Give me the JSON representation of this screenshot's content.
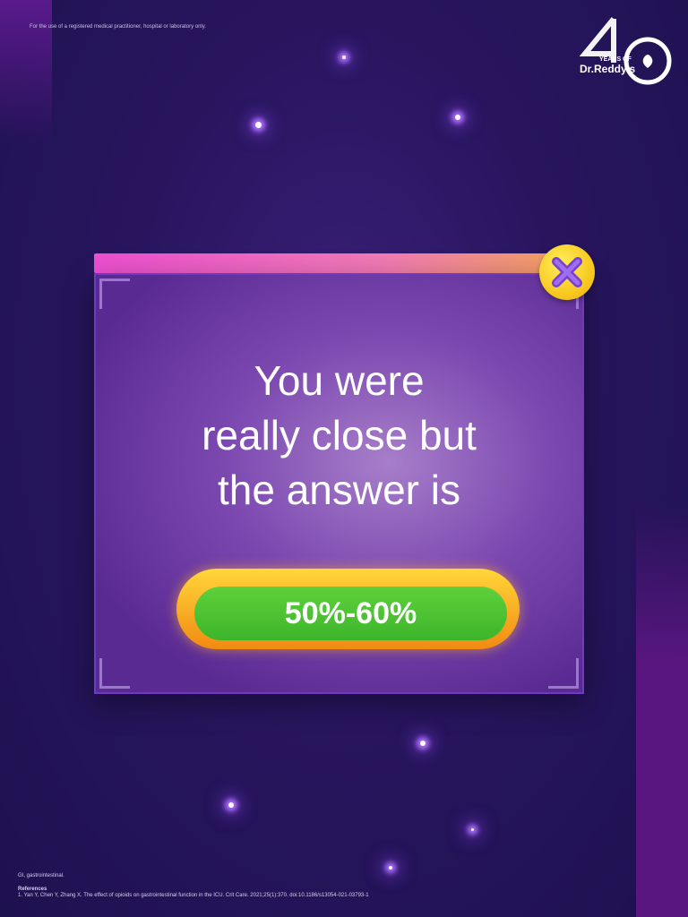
{
  "header": {
    "disclaimer": "For the use of a registered medical practitioner, hospital or laboratory only.",
    "logo_text": "40 YEARS OF Dr.Reddy's"
  },
  "dialog": {
    "message_lines": [
      "You were",
      "really close but",
      "the answer is"
    ],
    "answer": "50%-60%",
    "close_icon": "close-x-icon"
  },
  "footer": {
    "abbreviation": "GI, gastrointestinal.",
    "references_heading": "References",
    "reference_1": "1. Yan Y, Chen Y, Zhang X. The effect of opioids on gastrointestinal function in the ICU. Crit Care. 2021;25(1):370. doi:10.1186/s13054-021-03793-1"
  },
  "colors": {
    "accent_green": "#4cc233",
    "accent_gold": "#f6c419",
    "panel_purple": "#7b48b0"
  }
}
